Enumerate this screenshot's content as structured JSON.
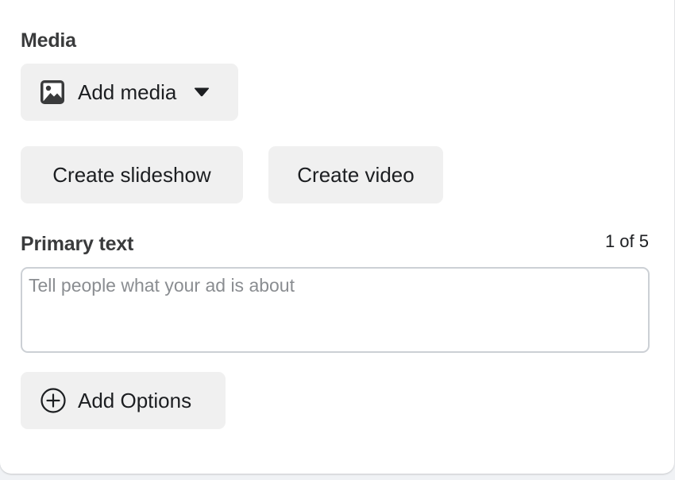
{
  "media": {
    "label": "Media",
    "add_media_label": "Add media",
    "media_icon": "image-icon",
    "caret_icon": "caret-down-icon"
  },
  "actions": {
    "create_slideshow_label": "Create slideshow",
    "create_video_label": "Create video"
  },
  "primary_text": {
    "label": "Primary text",
    "counter": "1 of 5",
    "value": "",
    "placeholder": "Tell people what your ad is about"
  },
  "options": {
    "add_options_label": "Add Options",
    "icon": "plus-circle-icon"
  },
  "colors": {
    "button_bg": "#f0f0f0",
    "text": "#1c1e21",
    "label_text": "#3a3b3c",
    "input_border": "#ccd0d5",
    "placeholder": "#8a8d91"
  }
}
